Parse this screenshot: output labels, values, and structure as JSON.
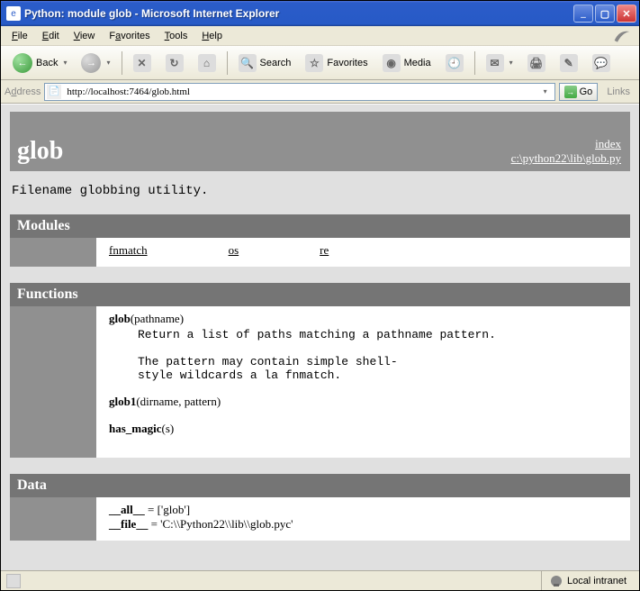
{
  "window": {
    "title": "Python: module glob - Microsoft Internet Explorer"
  },
  "menu": {
    "file": "File",
    "edit": "Edit",
    "view": "View",
    "favorites": "Favorites",
    "tools": "Tools",
    "help": "Help"
  },
  "toolbar": {
    "back": "Back",
    "search": "Search",
    "favorites": "Favorites",
    "media": "Media"
  },
  "address": {
    "label": "Address",
    "url": "http://localhost:7464/glob.html",
    "go": "Go",
    "links": "Links"
  },
  "pydoc": {
    "module_name": "glob",
    "index_label": "index",
    "source_path": "c:\\python22\\lib\\glob.py",
    "description": "Filename globbing utility.",
    "sections": {
      "modules": {
        "heading": "Modules",
        "items": [
          "fnmatch",
          "os",
          "re"
        ]
      },
      "functions": {
        "heading": "Functions",
        "items": [
          {
            "name": "glob",
            "args": "(pathname)",
            "doc": "Return a list of paths matching a pathname pattern.\n\nThe pattern may contain simple shell-\nstyle wildcards a la fnmatch."
          },
          {
            "name": "glob1",
            "args": "(dirname, pattern)",
            "doc": ""
          },
          {
            "name": "has_magic",
            "args": "(s)",
            "doc": ""
          }
        ]
      },
      "data": {
        "heading": "Data",
        "items": [
          {
            "name": "__all__",
            "value": " = ['glob']"
          },
          {
            "name": "__file__",
            "value": " = 'C:\\\\Python22\\\\lib\\\\glob.pyc'"
          }
        ]
      }
    }
  },
  "status": {
    "zone": "Local intranet"
  }
}
